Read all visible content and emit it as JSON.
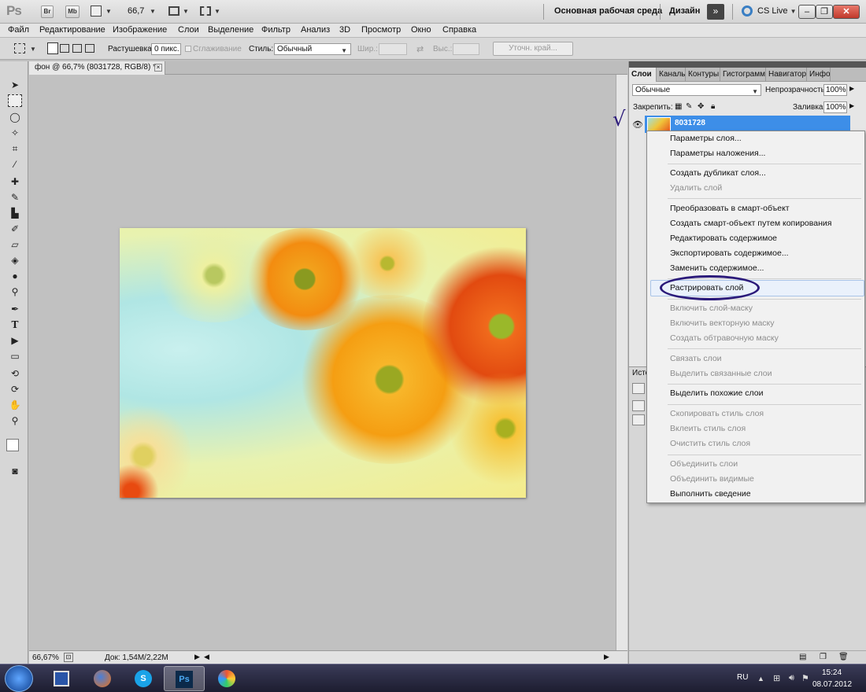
{
  "appbar": {
    "logo": "Ps",
    "btn_br": "Br",
    "btn_mb": "Mb",
    "zoom": "66,7",
    "workspace_main": "Основная рабочая среда",
    "workspace_design": "Дизайн",
    "more": "»",
    "cslive": "CS Live"
  },
  "menu": [
    "Файл",
    "Редактирование",
    "Изображение",
    "Слои",
    "Выделение",
    "Фильтр",
    "Анализ",
    "3D",
    "Просмотр",
    "Окно",
    "Справка"
  ],
  "options": {
    "feather_label": "Растушевка:",
    "feather_value": "0 пикс.",
    "antialias_label": "Сглаживание",
    "style_label": "Стиль:",
    "style_value": "Обычный",
    "width_label": "Шир.:",
    "height_label": "Выс.:",
    "refine_edge": "Уточн. край..."
  },
  "document": {
    "tab_title": "фон @ 66,7% (8031728, RGB/8) *",
    "close": "×",
    "status_zoom": "66,67%",
    "status_doc": "Док: 1,54M/2,22M"
  },
  "panel": {
    "tabs": [
      "Слои",
      "Каналы",
      "Контуры",
      "Гистограмма",
      "Навигатор",
      "Инфо"
    ],
    "blend_mode": "Обычные",
    "opacity_label": "Непрозрачность:",
    "opacity_value": "100%",
    "lock_label": "Закрепить:",
    "fill_label": "Заливка:",
    "fill_value": "100%",
    "layer_name": "8031728",
    "history_tab": "Исто"
  },
  "context_menu": {
    "items": [
      {
        "label": "Параметры слоя...",
        "disabled": false
      },
      {
        "label": "Параметры наложения...",
        "disabled": false
      },
      {
        "label": "Создать дубликат слоя...",
        "disabled": false
      },
      {
        "label": "Удалить слой",
        "disabled": true
      },
      {
        "label": "Преобразовать в смарт-объект",
        "disabled": false
      },
      {
        "label": "Создать смарт-объект путем копирования",
        "disabled": false
      },
      {
        "label": "Редактировать содержимое",
        "disabled": false
      },
      {
        "label": "Экспортировать содержимое...",
        "disabled": false
      },
      {
        "label": "Заменить содержимое...",
        "disabled": false
      },
      {
        "label": "Растрировать слой",
        "disabled": false,
        "highlighted": true
      },
      {
        "label": "Включить слой-маску",
        "disabled": true
      },
      {
        "label": "Включить векторную маску",
        "disabled": true
      },
      {
        "label": "Создать обтравочную маску",
        "disabled": true
      },
      {
        "label": "Связать слои",
        "disabled": true
      },
      {
        "label": "Выделить связанные слои",
        "disabled": true
      },
      {
        "label": "Выделить похожие слои",
        "disabled": false
      },
      {
        "label": "Скопировать стиль слоя",
        "disabled": true
      },
      {
        "label": "Вклеить стиль слоя",
        "disabled": true
      },
      {
        "label": "Очистить стиль слоя",
        "disabled": true
      },
      {
        "label": "Объединить слои",
        "disabled": true
      },
      {
        "label": "Объединить видимые",
        "disabled": true
      },
      {
        "label": "Выполнить сведение",
        "disabled": false
      }
    ]
  },
  "annotation": {
    "checkmark": "√"
  },
  "taskbar": {
    "lang": "RU",
    "time": "15:24",
    "date": "08.07.2012"
  },
  "colors": {
    "highlight_circle": "#2b1a7a",
    "layer_selected": "#3d8ee8"
  }
}
